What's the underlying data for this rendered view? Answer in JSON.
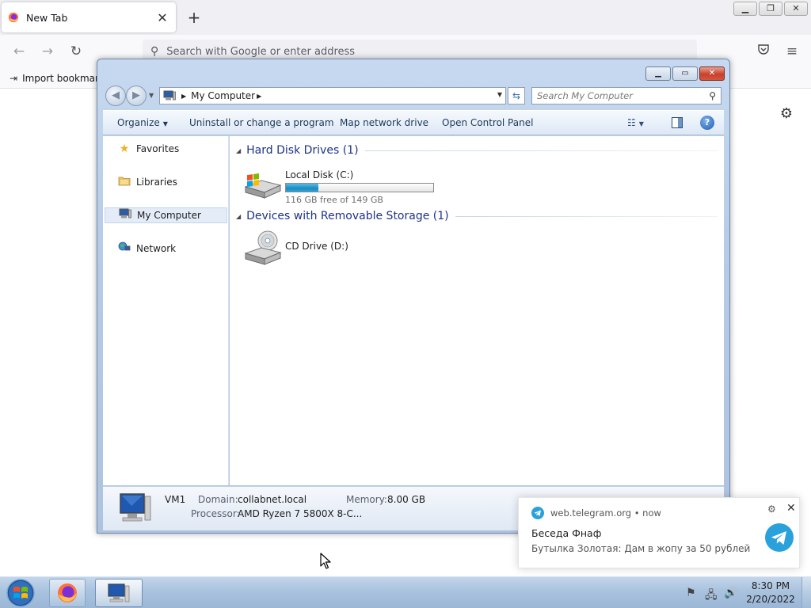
{
  "browser": {
    "tab_title": "New Tab",
    "tab_close": "✕",
    "new_tab": "+",
    "url_placeholder": "Search with Google or enter address",
    "bookmark_label": "Import bookmarks..."
  },
  "explorer": {
    "address": "My Computer",
    "search_placeholder": "Search My Computer",
    "toolbar": {
      "organize": "Organize",
      "uninstall": "Uninstall or change a program",
      "map_drive": "Map network drive",
      "control_panel": "Open Control Panel"
    },
    "nav": {
      "favorites": "Favorites",
      "libraries": "Libraries",
      "my_computer": "My Computer",
      "network": "Network"
    },
    "groups": {
      "hdd": "Hard Disk Drives (1)",
      "removable": "Devices with Removable Storage (1)"
    },
    "drives": {
      "c": {
        "name": "Local Disk (C:)",
        "free": "116 GB free of 149 GB",
        "used_fraction": 0.22
      },
      "d": {
        "name": "CD Drive (D:)"
      }
    },
    "details": {
      "name": "VM1",
      "domain_label": "Domain:",
      "domain": "collabnet.local",
      "memory_label": "Memory:",
      "memory": "8.00 GB",
      "processor_label": "Processor:",
      "processor": "AMD Ryzen 7 5800X 8-C..."
    }
  },
  "notification": {
    "source": "web.telegram.org  •  now",
    "title": "Беседа Фнаф",
    "body": "Бутылка Золотая: Дам в жопу за 50 рублей"
  },
  "taskbar": {
    "time": "8:30 PM",
    "date": "2/20/2022"
  },
  "colors": {
    "telegram": "#2aa1da",
    "firefox_orange": "#ff7139",
    "link_blue": "#1e3287"
  }
}
